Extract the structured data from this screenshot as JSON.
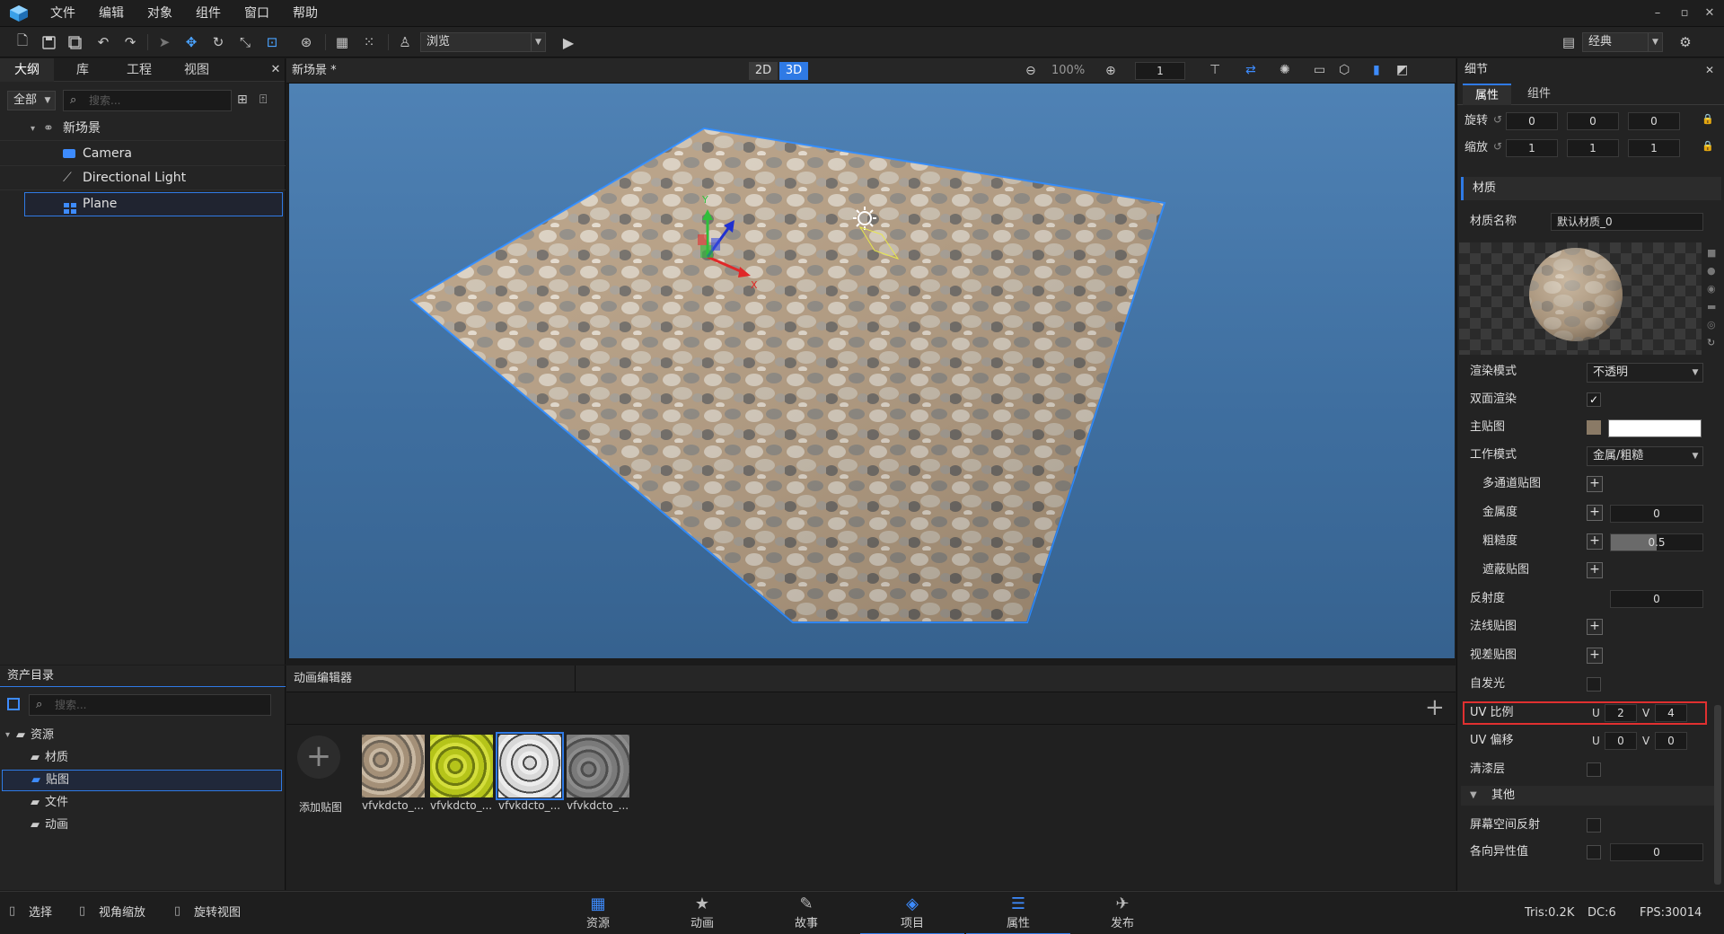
{
  "menu": [
    "文件",
    "编辑",
    "对象",
    "组件",
    "窗口",
    "帮助"
  ],
  "window_controls": [
    "–",
    "▫",
    "✕"
  ],
  "toolbar": {
    "view_mode": "浏览",
    "layout_mode": "经典"
  },
  "outline": {
    "tabs": [
      "大纲",
      "库",
      "工程",
      "视图"
    ],
    "filter": "全部",
    "search_placeholder": "搜索...",
    "tree": [
      {
        "label": "新场景",
        "icon": "scene-icon"
      },
      {
        "label": "Camera",
        "icon": "camera-icon"
      },
      {
        "label": "Directional Light",
        "icon": "light-icon"
      },
      {
        "label": "Plane",
        "icon": "mesh-icon",
        "selected": true
      }
    ]
  },
  "viewport": {
    "title": "新场景 *",
    "mode_2d": "2D",
    "mode_3d": "3D",
    "zoom": "100%",
    "step": "1",
    "axis_x": "X",
    "axis_y": "Y"
  },
  "details": {
    "title": "细节",
    "tabs": [
      "属性",
      "组件"
    ],
    "rotation": {
      "label": "旋转",
      "values": [
        "0",
        "0",
        "0"
      ]
    },
    "scale": {
      "label": "缩放",
      "values": [
        "1",
        "1",
        "1"
      ]
    },
    "material_section": "材质",
    "material_name_label": "材质名称",
    "material_name": "默认材质_0",
    "render_mode_label": "渲染模式",
    "render_mode": "不透明",
    "double_sided_label": "双面渲染",
    "double_sided": true,
    "main_texture_label": "主贴图",
    "work_mode_label": "工作模式",
    "work_mode": "金属/粗糙",
    "multi_channel_label": "多通道贴图",
    "metalness_label": "金属度",
    "metalness": "0",
    "roughness_label": "粗糙度",
    "roughness": "0.5",
    "roughness_fill": 0.5,
    "occlusion_label": "遮蔽贴图",
    "reflectivity_label": "反射度",
    "reflectivity": "0",
    "normal_label": "法线贴图",
    "parallax_label": "视差贴图",
    "emissive_label": "自发光",
    "uv_scale_label": "UV 比例",
    "uv_scale_u": "2",
    "uv_scale_v": "4",
    "uv_offset_label": "UV 偏移",
    "uv_offset_u": "0",
    "uv_offset_v": "0",
    "u": "U",
    "v": "V",
    "clearcoat_label": "清漆层",
    "other_section": "其他",
    "ssr_label": "屏幕空间反射",
    "anisotropy_label": "各向异性值",
    "anisotropy": "0",
    "highlight_color": "#e03030"
  },
  "assets": {
    "title": "资产目录",
    "search_placeholder": "搜索...",
    "tree": [
      {
        "label": "资源",
        "level": 0
      },
      {
        "label": "材质",
        "level": 1
      },
      {
        "label": "贴图",
        "level": 1,
        "selected": true
      },
      {
        "label": "文件",
        "level": 1
      },
      {
        "label": "动画",
        "level": 1
      }
    ]
  },
  "anim_editor": {
    "title": "动画编辑器",
    "add_texture": "添加贴图",
    "thumbnails": [
      "vfvkdcto_...",
      "vfvkdcto_...",
      "vfvkdcto_...",
      "vfvkdcto_..."
    ]
  },
  "status": {
    "select": "选择",
    "zoom_view": "视角缩放",
    "rotate_view": "旋转视图",
    "tris": "Tris:0.2K",
    "dc": "DC:6",
    "fps": "FPS:30014"
  },
  "bottom_tabs": [
    {
      "label": "资源",
      "icon": "assets-icon"
    },
    {
      "label": "动画",
      "icon": "animation-icon"
    },
    {
      "label": "故事",
      "icon": "story-icon"
    },
    {
      "label": "项目",
      "icon": "project-icon"
    },
    {
      "label": "属性",
      "icon": "properties-icon"
    },
    {
      "label": "发布",
      "icon": "publish-icon"
    }
  ]
}
